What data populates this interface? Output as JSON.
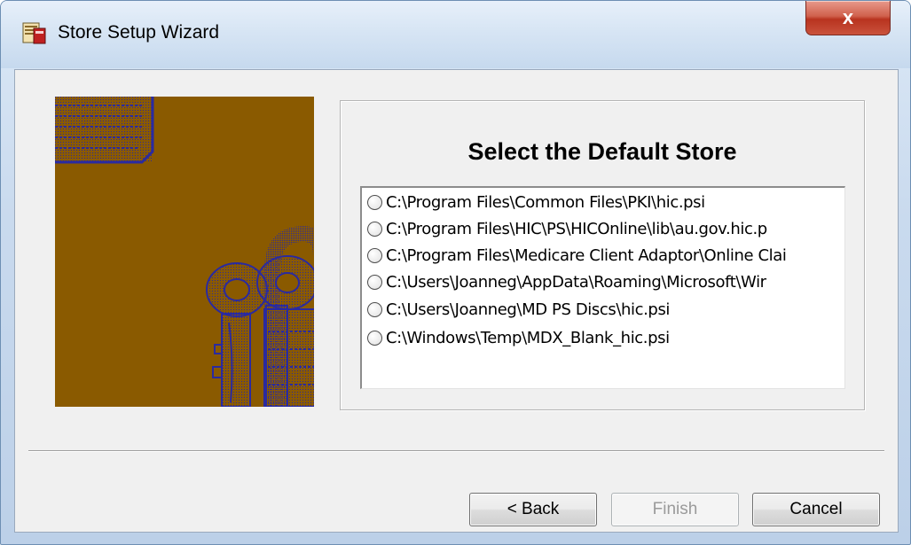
{
  "window": {
    "title": "Store Setup Wizard",
    "close_label": "x"
  },
  "panel": {
    "heading": "Select the Default Store"
  },
  "stores": [
    "C:\\Program Files\\Common Files\\PKI\\hic.psi",
    "C:\\Program Files\\HIC\\PS\\HICOnline\\lib\\au.gov.hic.p",
    "C:\\Program Files\\Medicare Client Adaptor\\Online Clai",
    "C:\\Users\\Joanneg\\AppData\\Roaming\\Microsoft\\Wir",
    "C:\\Users\\Joanneg\\MD PS Discs\\hic.psi",
    "C:\\Windows\\Temp\\MDX_Blank_hic.psi"
  ],
  "buttons": {
    "back": "< Back",
    "finish": "Finish",
    "cancel": "Cancel"
  },
  "colors": {
    "art_background": "#8a5a00",
    "art_ink": "#2a2aa0"
  },
  "icons": {
    "title": "wizard-app-icon",
    "art": "keys-and-lock-illustration"
  }
}
